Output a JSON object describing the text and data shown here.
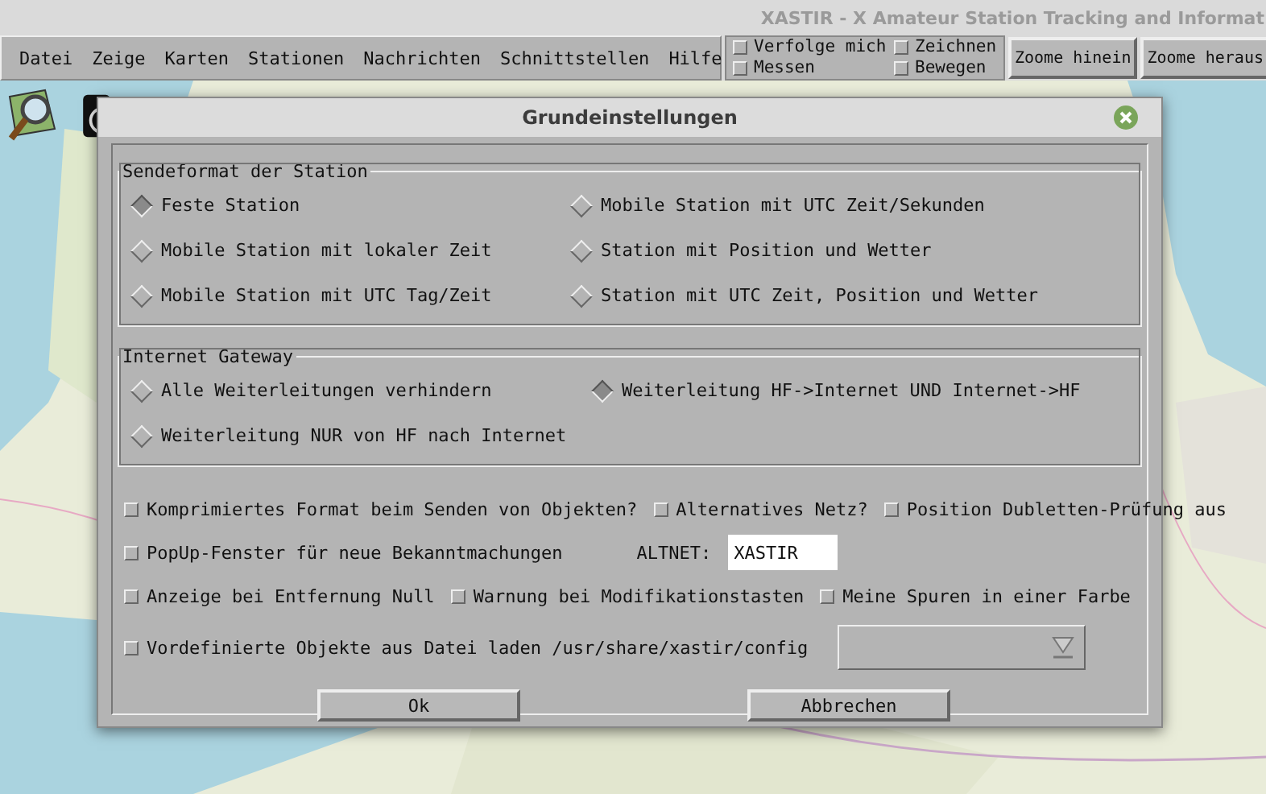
{
  "app_window": {
    "title": "XASTIR - X Amateur Station Tracking and Informat"
  },
  "menu": [
    "Datei",
    "Zeige",
    "Karten",
    "Stationen",
    "Nachrichten",
    "Schnittstellen",
    "Hilfe"
  ],
  "toolbar_toggles": [
    {
      "label": "Verfolge mich",
      "checked": false
    },
    {
      "label": "Zeichnen",
      "checked": false
    },
    {
      "label": "Messen",
      "checked": false
    },
    {
      "label": "Bewegen",
      "checked": false
    }
  ],
  "toolbar_buttons": [
    "Zoome hinein",
    "Zoome heraus"
  ],
  "map": {
    "kind": "picture"
  },
  "dialog": {
    "title": "Grundeinstellungen",
    "groups": [
      {
        "title": "Sendeformat der Station",
        "options": [
          {
            "label": "Feste Station",
            "selected": true
          },
          {
            "label": "Mobile Station mit UTC Zeit/Sekunden",
            "selected": false
          },
          {
            "label": "Mobile Station mit lokaler Zeit",
            "selected": false
          },
          {
            "label": "Station mit Position und Wetter",
            "selected": false
          },
          {
            "label": "Mobile Station mit UTC Tag/Zeit",
            "selected": false
          },
          {
            "label": "Station mit UTC Zeit, Position und Wetter",
            "selected": false
          }
        ]
      },
      {
        "title": "Internet Gateway",
        "options": [
          {
            "label": "Alle Weiterleitungen verhindern",
            "selected": false
          },
          {
            "label": "Weiterleitung HF->Internet UND Internet->HF",
            "selected": true
          },
          {
            "label": "Weiterleitung NUR von HF nach Internet",
            "selected": false
          }
        ]
      }
    ],
    "rows": [
      [
        {
          "kind": "checkbox",
          "label": "Komprimiertes Format beim Senden von Objekten?",
          "checked": false
        },
        {
          "kind": "checkbox",
          "label": "Alternatives Netz?",
          "checked": false
        },
        {
          "kind": "checkbox",
          "label": "Position Dubletten-Prüfung aus",
          "checked": false
        }
      ],
      [
        {
          "kind": "checkbox",
          "label": "PopUp-Fenster für neue Bekanntmachungen",
          "checked": false
        },
        {
          "kind": "field",
          "label": "ALTNET:",
          "value": "XASTIR"
        }
      ],
      [
        {
          "kind": "checkbox",
          "label": "Anzeige bei Entfernung Null",
          "checked": false
        },
        {
          "kind": "checkbox",
          "label": "Warnung bei Modifikationstasten",
          "checked": false
        },
        {
          "kind": "checkbox",
          "label": "Meine Spuren in einer Farbe",
          "checked": false
        }
      ],
      [
        {
          "kind": "checkbox",
          "label": "Vordefinierte Objekte aus Datei laden /usr/share/xastir/config",
          "checked": false
        },
        {
          "kind": "dropdown"
        }
      ]
    ],
    "buttons": [
      "Ok",
      "Abbrechen"
    ]
  }
}
